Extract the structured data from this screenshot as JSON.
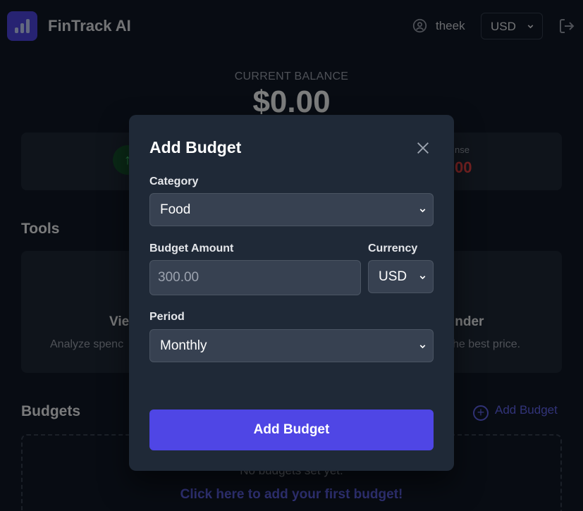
{
  "header": {
    "brand": "FinTrack AI",
    "user_name": "theek",
    "currency": "USD"
  },
  "balance": {
    "label": "CURRENT BALANCE",
    "value": "$0.00"
  },
  "summary": {
    "expense_label": "nse",
    "expense_value": "00"
  },
  "tools": {
    "title": "Tools",
    "left_title": "Vie",
    "left_desc": "Analyze spenc",
    "right_title": "inder",
    "right_desc": "he best price."
  },
  "budgets": {
    "title": "Budgets",
    "add_link": "Add Budget",
    "empty_text": "No budgets set yet.",
    "empty_link": "Click here to add your first budget!"
  },
  "modal": {
    "title": "Add Budget",
    "category_label": "Category",
    "category_value": "Food",
    "amount_label": "Budget Amount",
    "amount_placeholder": "300.00",
    "currency_label": "Currency",
    "currency_value": "USD",
    "period_label": "Period",
    "period_value": "Monthly",
    "submit_label": "Add Budget"
  },
  "colors": {
    "background": "#111827",
    "card": "#1f2937",
    "accent": "#4f46e5",
    "expense": "#ef4444",
    "income": "#4ade80"
  }
}
